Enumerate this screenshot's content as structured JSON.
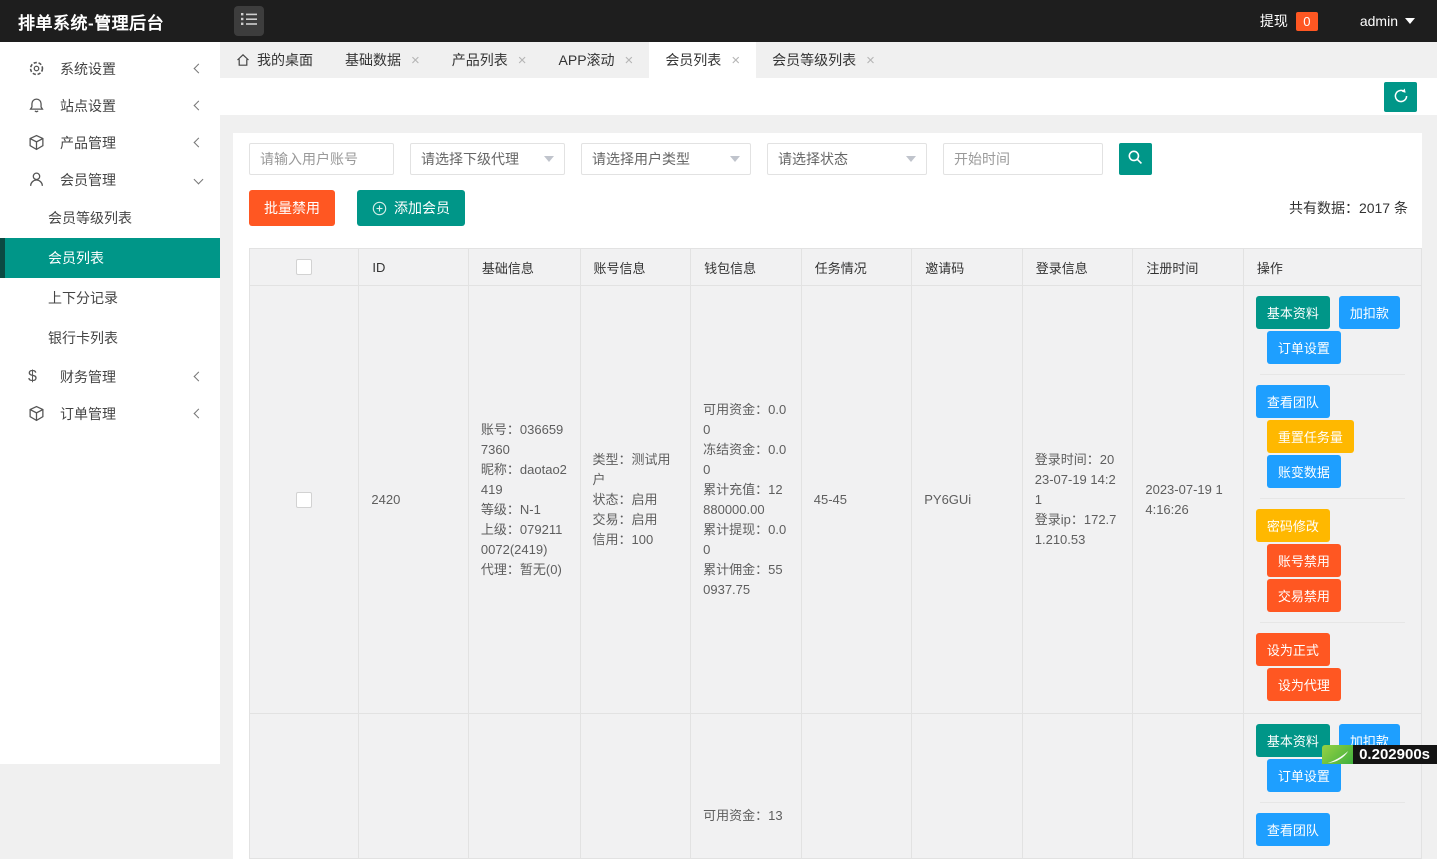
{
  "topbar": {
    "title": "排单系统-管理后台",
    "withdraw_label": "提现",
    "withdraw_badge": "0",
    "username": "admin"
  },
  "sidebar": {
    "items": [
      {
        "label": "系统设置",
        "icon": "gear-icon"
      },
      {
        "label": "站点设置",
        "icon": "bell-icon"
      },
      {
        "label": "产品管理",
        "icon": "cube-icon"
      },
      {
        "label": "会员管理",
        "icon": "user-icon",
        "children": [
          {
            "label": "会员等级列表"
          },
          {
            "label": "会员列表",
            "active": true
          },
          {
            "label": "上下分记录"
          },
          {
            "label": "银行卡列表"
          }
        ]
      },
      {
        "label": "财务管理",
        "icon": "dollar-icon"
      },
      {
        "label": "订单管理",
        "icon": "cube-icon"
      }
    ]
  },
  "tabs": [
    {
      "label": "我的桌面",
      "closable": false
    },
    {
      "label": "基础数据",
      "closable": true
    },
    {
      "label": "产品列表",
      "closable": true
    },
    {
      "label": "APP滚动",
      "closable": true
    },
    {
      "label": "会员列表",
      "closable": true,
      "active": true
    },
    {
      "label": "会员等级列表",
      "closable": true
    }
  ],
  "filters": {
    "account_placeholder": "请输入用户账号",
    "agent_placeholder": "请选择下级代理",
    "user_type_placeholder": "请选择用户类型",
    "status_placeholder": "请选择状态",
    "start_time_placeholder": "开始时间"
  },
  "actions": {
    "batch_disable": "批量禁用",
    "add_member": "添加会员",
    "total_text": "共有数据：2017 条"
  },
  "table": {
    "columns": [
      "ID",
      "基础信息",
      "账号信息",
      "钱包信息",
      "任务情况",
      "邀请码",
      "登录信息",
      "注册时间",
      "操作"
    ]
  },
  "members": [
    {
      "id": "2420",
      "basic_lines": [
        "账号：0366597360",
        "昵称：daotao2419",
        "等级：N-1",
        "上级：0792110072(2419)",
        "代理：暂无(0)"
      ],
      "account_lines": [
        "类型：测试用户",
        "状态：启用",
        "交易：启用",
        "信用：100"
      ],
      "wallet_lines": [
        "可用资金：0.00",
        "冻结资金：0.00",
        "累计充值：12880000.00",
        "累计提现：0.00",
        "累计佣金：550937.75"
      ],
      "tasks": "45-45",
      "invite_code": "PY6GUi",
      "login_lines": [
        "登录时间：2023-07-19 14:21",
        "登录ip：172.71.210.53"
      ],
      "register_time": "2023-07-19 14:16:26"
    },
    {
      "wallet_partial": "可用资金：13"
    }
  ],
  "operations": {
    "basic_profile": "基本资料",
    "add_deduct": "加扣款",
    "order_settings": "订单设置",
    "view_team": "查看团队",
    "reset_tasks": "重置任务量",
    "account_changes": "账变数据",
    "change_password": "密码修改",
    "disable_account": "账号禁用",
    "disable_trading": "交易禁用",
    "set_official": "设为正式",
    "set_agent": "设为代理"
  },
  "debug": {
    "elapsed": "0.202900s"
  },
  "colors": {
    "topbar_bg": "#1e1e1e",
    "teal": "#009688",
    "blue": "#1E9FFF",
    "yellow": "#FFB800",
    "red": "#FF5722"
  }
}
